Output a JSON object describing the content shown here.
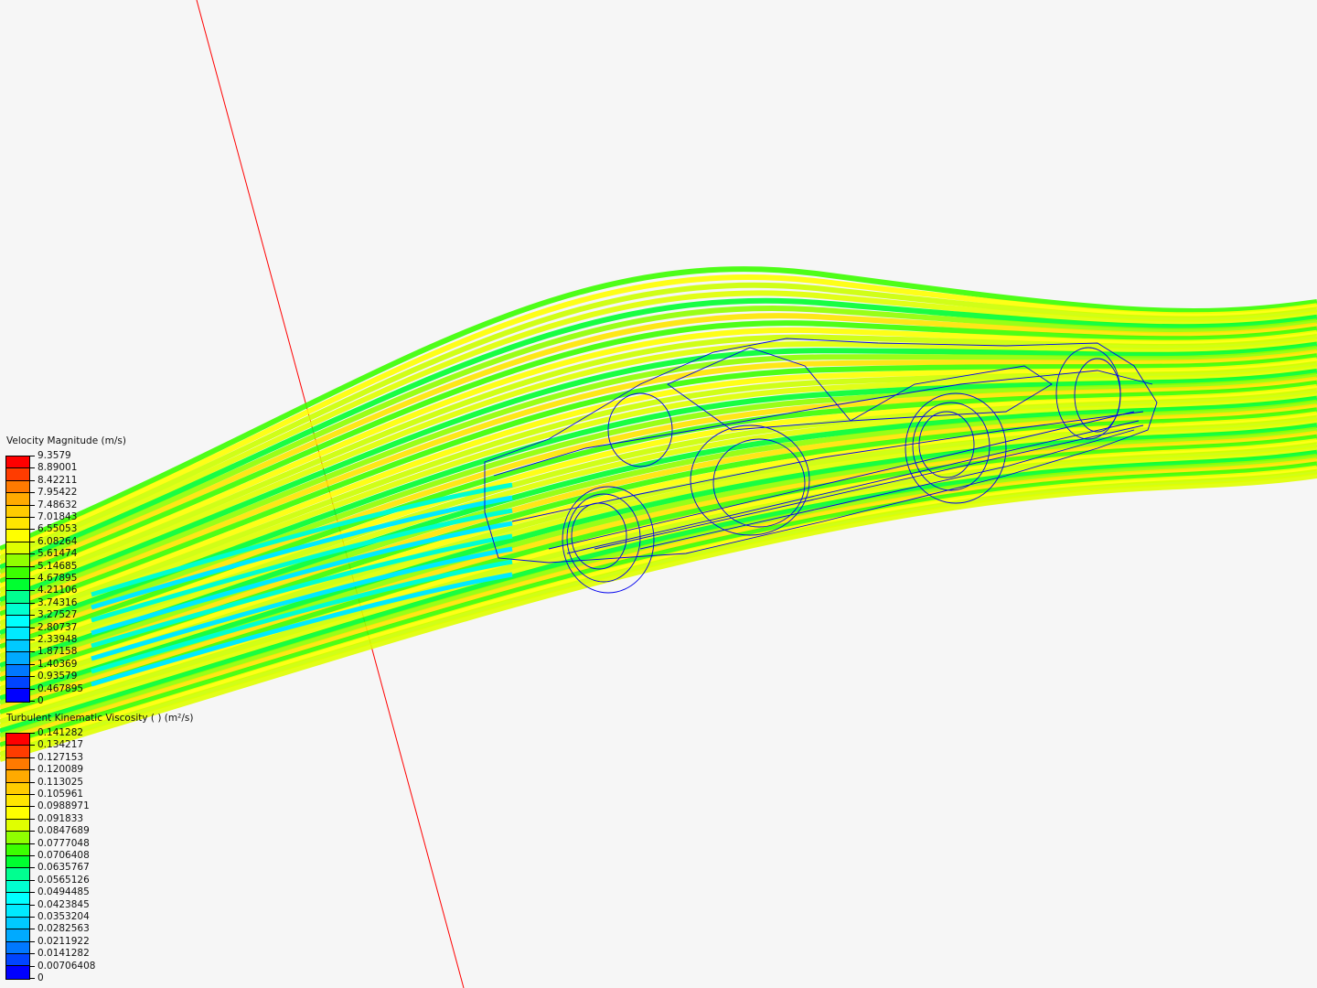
{
  "colors": {
    "background": "#f6f6f6",
    "axis_line": "#ff0000",
    "wireframe": "#0000ee",
    "colormap": [
      "#ff0000",
      "#ff3c00",
      "#ff7a00",
      "#ffaa00",
      "#ffcc00",
      "#ffe600",
      "#ffff00",
      "#e0ff00",
      "#90ff00",
      "#3cff00",
      "#00ff30",
      "#00ff90",
      "#00ffd0",
      "#00ffff",
      "#00eaff",
      "#00caff",
      "#00aaff",
      "#0078ff",
      "#0044ff",
      "#0000ff"
    ]
  },
  "legends": [
    {
      "title": "Velocity Magnitude (m/s)",
      "labels": [
        "9.3579",
        "8.89001",
        "8.42211",
        "7.95422",
        "7.48632",
        "7.01843",
        "6.55053",
        "6.08264",
        "5.61474",
        "5.14685",
        "4.67895",
        "4.21106",
        "3.74316",
        "3.27527",
        "2.80737",
        "2.33948",
        "1.87158",
        "1.40369",
        "0.93579",
        "0.467895",
        "0"
      ]
    },
    {
      "title": "Turbulent Kinematic Viscosity (        ) (m²/s)",
      "labels": [
        "0.141282",
        "0.134217",
        "0.127153",
        "0.120089",
        "0.113025",
        "0.105961",
        "0.0988971",
        "0.091833",
        "0.0847689",
        "0.0777048",
        "0.0706408",
        "0.0635767",
        "0.0565126",
        "0.0494485",
        "0.0423845",
        "0.0353204",
        "0.0282563",
        "0.0211922",
        "0.0141282",
        "0.00706408",
        "0"
      ]
    }
  ]
}
